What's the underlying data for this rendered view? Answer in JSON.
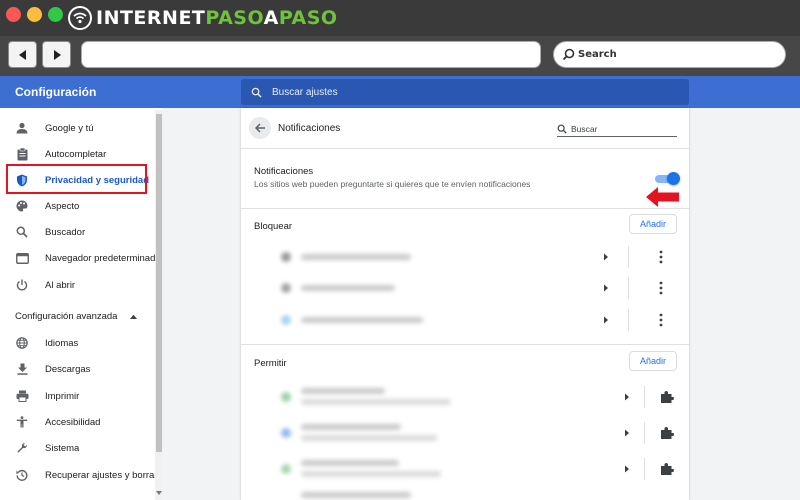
{
  "window": {
    "logo_part1": "INTERNET",
    "logo_part2": "PASO",
    "logo_part3": "A",
    "logo_part4": "PASO",
    "search_label": "Search"
  },
  "header": {
    "title": "Configuración",
    "search_placeholder": "Buscar ajustes"
  },
  "sidebar": {
    "items": [
      {
        "label": "Google y tú",
        "icon": "person-icon"
      },
      {
        "label": "Autocompletar",
        "icon": "clipboard-icon"
      },
      {
        "label": "Privacidad y seguridad",
        "icon": "shield-icon",
        "active": true
      },
      {
        "label": "Aspecto",
        "icon": "palette-icon"
      },
      {
        "label": "Buscador",
        "icon": "search-icon"
      },
      {
        "label": "Navegador predeterminado",
        "icon": "browser-icon"
      },
      {
        "label": "Al abrir",
        "icon": "power-icon"
      }
    ],
    "advanced_label": "Configuración avanzada",
    "advanced_items": [
      {
        "label": "Idiomas",
        "icon": "globe-icon"
      },
      {
        "label": "Descargas",
        "icon": "download-icon"
      },
      {
        "label": "Imprimir",
        "icon": "printer-icon"
      },
      {
        "label": "Accesibilidad",
        "icon": "accessibility-icon"
      },
      {
        "label": "Sistema",
        "icon": "wrench-icon"
      },
      {
        "label": "Recuperar ajustes y borrar",
        "icon": "restore-icon"
      }
    ]
  },
  "page": {
    "title": "Notificaciones",
    "search_placeholder": "Buscar",
    "notifications": {
      "title": "Notificaciones",
      "description": "Los sitios web pueden preguntarte si quieres que te envíen notificaciones",
      "enabled": true
    },
    "block_section": {
      "label": "Bloquear",
      "add_label": "Añadir"
    },
    "allow_section": {
      "label": "Permitir",
      "add_label": "Añadir"
    }
  },
  "colors": {
    "accent": "#3c6fd1",
    "active_item": "#1a57c9",
    "highlight": "#e3141f",
    "toggle_on": "#1a73e8"
  }
}
